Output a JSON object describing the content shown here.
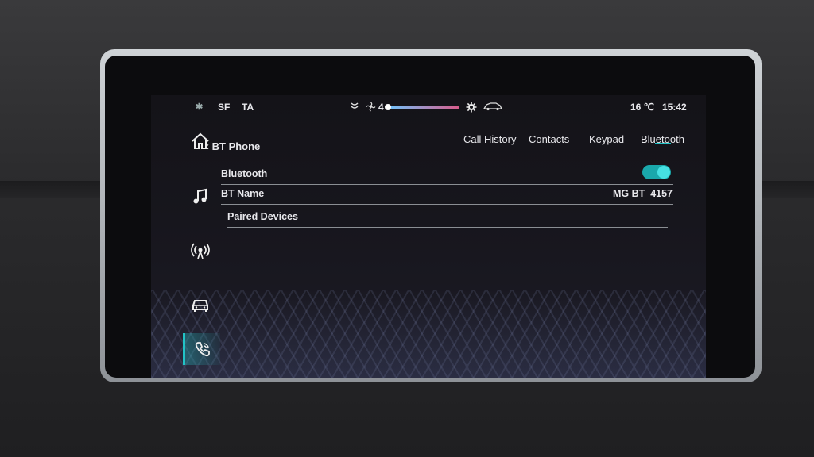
{
  "status_bar": {
    "bt_symbol": "✱",
    "sf": "SF",
    "ta": "TA",
    "fan_level": "4",
    "fan_fill_fraction": 0.0,
    "temperature": "16 ℃",
    "time": "15:42"
  },
  "sidebar": {
    "items": [
      {
        "icon": "home-icon"
      },
      {
        "icon": "music-icon"
      },
      {
        "icon": "radio-icon"
      },
      {
        "icon": "car-icon"
      },
      {
        "icon": "phone-icon",
        "active": true
      }
    ]
  },
  "header": {
    "back_label": "BT Phone"
  },
  "tabs": [
    {
      "label": "Call History"
    },
    {
      "label": "Contacts"
    },
    {
      "label": "Keypad"
    },
    {
      "label": "Bluetooth",
      "active": true
    }
  ],
  "settings": {
    "bluetooth_label": "Bluetooth",
    "bluetooth_enabled": true,
    "bt_name_label": "BT Name",
    "bt_name_value": "MG BT_4157",
    "paired_devices_label": "Paired Devices"
  },
  "colors": {
    "accent": "#22c3c6",
    "toggle_on": "#1aa8ab"
  }
}
